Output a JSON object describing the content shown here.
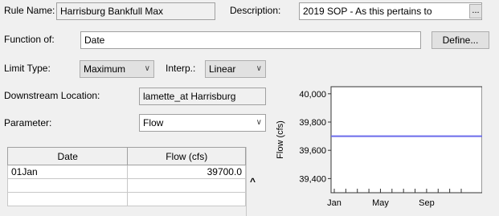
{
  "rule_name": {
    "label": "Rule Name:",
    "value": "Harrisburg Bankfull Max"
  },
  "description": {
    "label": "Description:",
    "value": "2019 SOP - As this pertains to",
    "button": "..."
  },
  "function_of": {
    "label": "Function of:",
    "value": "Date",
    "define_button": "Define..."
  },
  "limit_type": {
    "label": "Limit Type:",
    "value": "Maximum"
  },
  "interp": {
    "label": "Interp.:",
    "value": "Linear"
  },
  "downstream_location": {
    "label": "Downstream Location:",
    "value": "lamette_at Harrisburg"
  },
  "parameter": {
    "label": "Parameter:",
    "value": "Flow"
  },
  "table": {
    "headers": [
      "Date",
      "Flow (cfs)"
    ],
    "rows": [
      [
        "01Jan",
        "39700.0"
      ],
      [
        "",
        ""
      ],
      [
        "",
        ""
      ]
    ],
    "scroll_up": "^"
  },
  "chart_data": {
    "type": "line",
    "ylabel": "Flow (cfs)",
    "xlabel": "",
    "yticks": [
      "40,000",
      "39,800",
      "39,600",
      "39,400"
    ],
    "xticks": [
      "Jan",
      "May",
      "Sep"
    ],
    "ylim": [
      39300,
      40050
    ],
    "series": [
      {
        "x": [
          "Jan",
          "Dec"
        ],
        "values": [
          39700,
          39700
        ],
        "color": "#6b6bea"
      }
    ]
  }
}
